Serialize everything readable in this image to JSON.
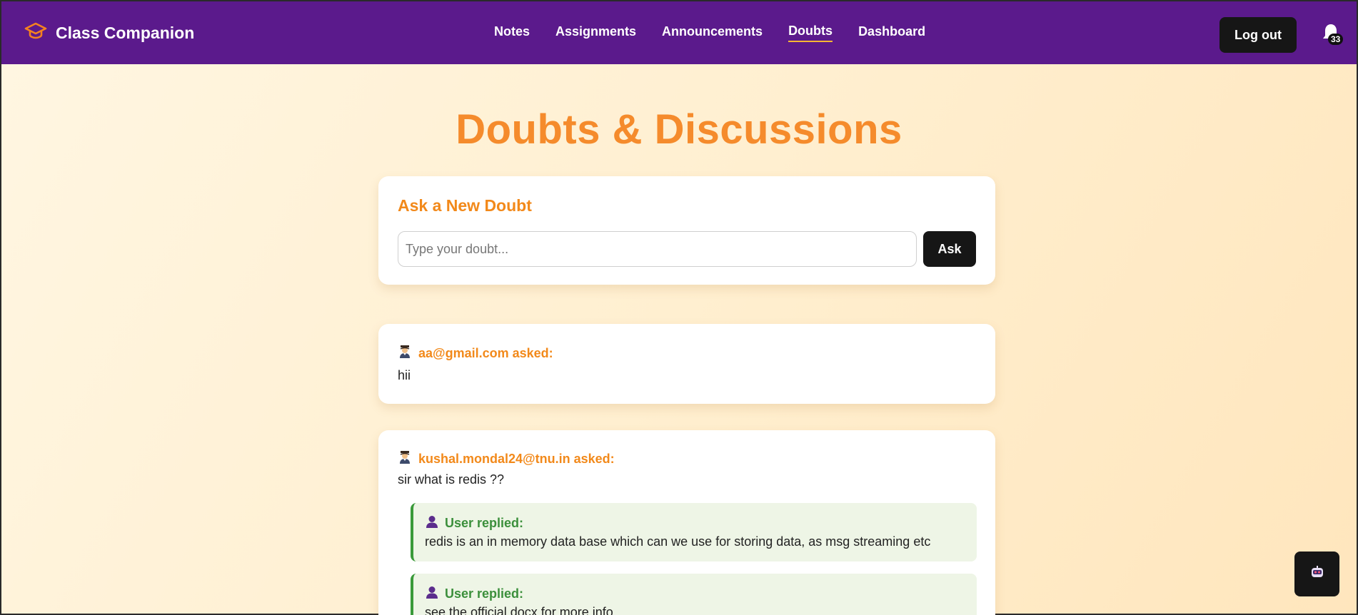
{
  "app": {
    "title": "Class Companion"
  },
  "nav": {
    "links": [
      {
        "label": "Notes"
      },
      {
        "label": "Assignments"
      },
      {
        "label": "Announcements"
      },
      {
        "label": "Doubts",
        "active": true
      },
      {
        "label": "Dashboard"
      }
    ],
    "logout_label": "Log out",
    "notification_count": "33"
  },
  "page": {
    "title": "Doubts & Discussions"
  },
  "ask": {
    "title": "Ask a New Doubt",
    "placeholder": "Type your doubt...",
    "value": "",
    "button_label": "Ask"
  },
  "doubts": [
    {
      "asker": "aa@gmail.com asked:",
      "text": "hii",
      "replies": []
    },
    {
      "asker": "kushal.mondal24@tnu.in asked:",
      "text": "sir what is redis ??",
      "replies": [
        {
          "author": "User replied:",
          "text": "redis is an in memory data base which can we use for storing data, as msg streaming etc"
        },
        {
          "author": "User replied:",
          "text": "see the official docx for more info"
        }
      ]
    }
  ],
  "colors": {
    "navbar": "#5b1a8c",
    "accent_orange": "#f58b2c",
    "reply_green": "#3b8f3b",
    "button_dark": "#161616"
  },
  "icons": {
    "brand": "graduation-cap-icon",
    "notifications": "bell-icon",
    "asker": "student-icon",
    "replier": "user-icon",
    "chatbot": "robot-icon"
  }
}
